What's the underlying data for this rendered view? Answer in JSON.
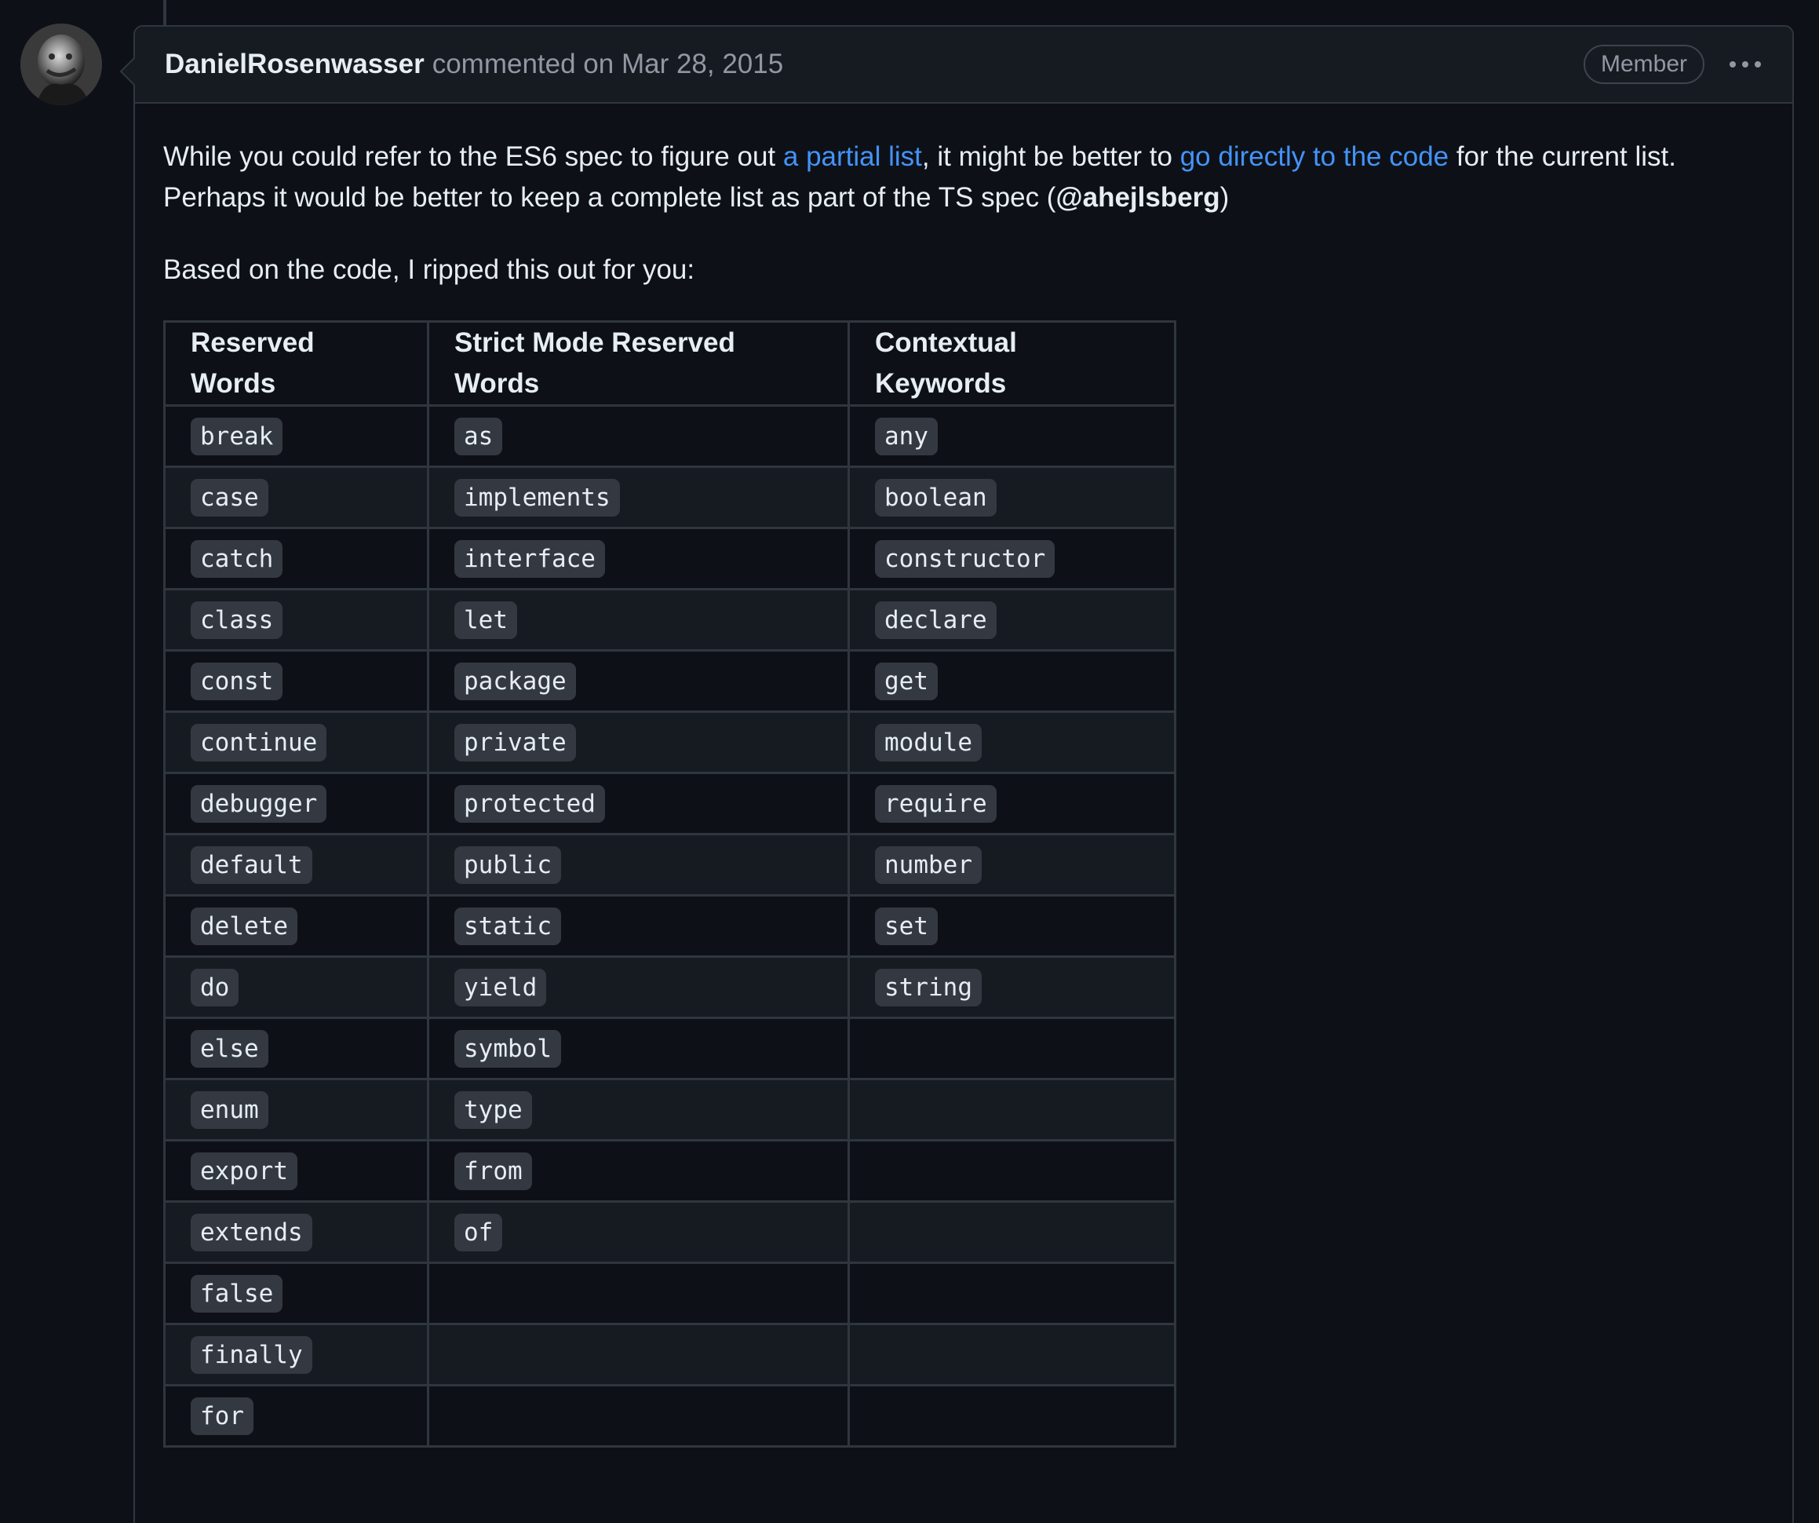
{
  "comment": {
    "author": "DanielRosenwasser",
    "meta": "commented on Mar 28, 2015",
    "badge": "Member",
    "more_label": "More options"
  },
  "body": {
    "p1_text1": "While you could refer to the ES6 spec to figure out ",
    "p1_link1": "a partial list",
    "p1_text2": ", it might be better to ",
    "p1_link2": "go directly to the code",
    "p1_text3": " for the current list. Perhaps it would be better to keep a complete list as part of the TS spec (",
    "p1_mention": "@ahejlsberg",
    "p1_text4": ")",
    "p2": "Based on the code, I ripped this out for you:"
  },
  "table": {
    "headers": [
      "Reserved Words",
      "Strict Mode Reserved Words",
      "Contextual Keywords"
    ],
    "rows": [
      [
        "break",
        "as",
        "any"
      ],
      [
        "case",
        "implements",
        "boolean"
      ],
      [
        "catch",
        "interface",
        "constructor"
      ],
      [
        "class",
        "let",
        "declare"
      ],
      [
        "const",
        "package",
        "get"
      ],
      [
        "continue",
        "private",
        "module"
      ],
      [
        "debugger",
        "protected",
        "require"
      ],
      [
        "default",
        "public",
        "number"
      ],
      [
        "delete",
        "static",
        "set"
      ],
      [
        "do",
        "yield",
        "string"
      ],
      [
        "else",
        "symbol",
        ""
      ],
      [
        "enum",
        "type",
        ""
      ],
      [
        "export",
        "from",
        ""
      ],
      [
        "extends",
        "of",
        ""
      ],
      [
        "false",
        "",
        ""
      ],
      [
        "finally",
        "",
        ""
      ],
      [
        "for",
        "",
        ""
      ]
    ]
  }
}
